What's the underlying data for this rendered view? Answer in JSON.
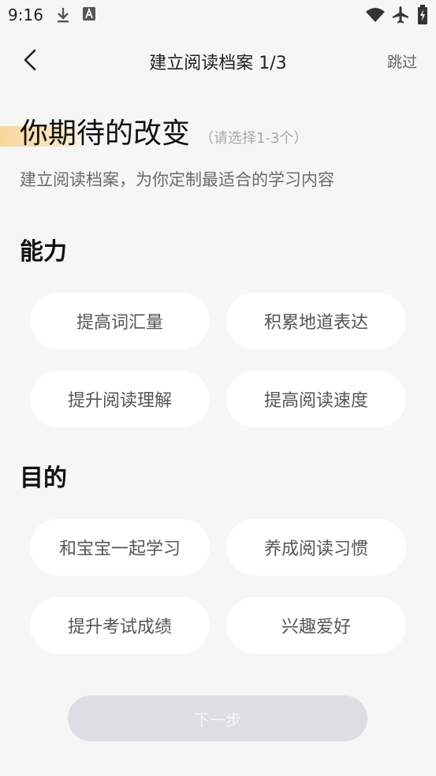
{
  "status_bar": {
    "time": "9:16",
    "icons": [
      "download-icon",
      "a-badge-icon",
      "wifi-icon",
      "airplane-icon",
      "battery-icon"
    ]
  },
  "header": {
    "back_icon": "chevron-left-icon",
    "title": "建立阅读档案 1/3",
    "skip_label": "跳过"
  },
  "intro": {
    "heading": "你期待的改变",
    "hint": "（请选择1-3个）",
    "subtitle": "建立阅读档案，为你定制最适合的学习内容"
  },
  "sections": [
    {
      "title": "能力",
      "options": [
        "提高词汇量",
        "积累地道表达",
        "提升阅读理解",
        "提高阅读速度"
      ]
    },
    {
      "title": "目的",
      "options": [
        "和宝宝一起学习",
        "养成阅读习惯",
        "提升考试成绩",
        "兴趣爱好"
      ]
    }
  ],
  "footer": {
    "next_label": "下一步"
  },
  "colors": {
    "background": "#f6f6f6",
    "chip_background": "#ffffff",
    "highlight": "#f6d79c",
    "disabled_button": "#dcdee3"
  }
}
